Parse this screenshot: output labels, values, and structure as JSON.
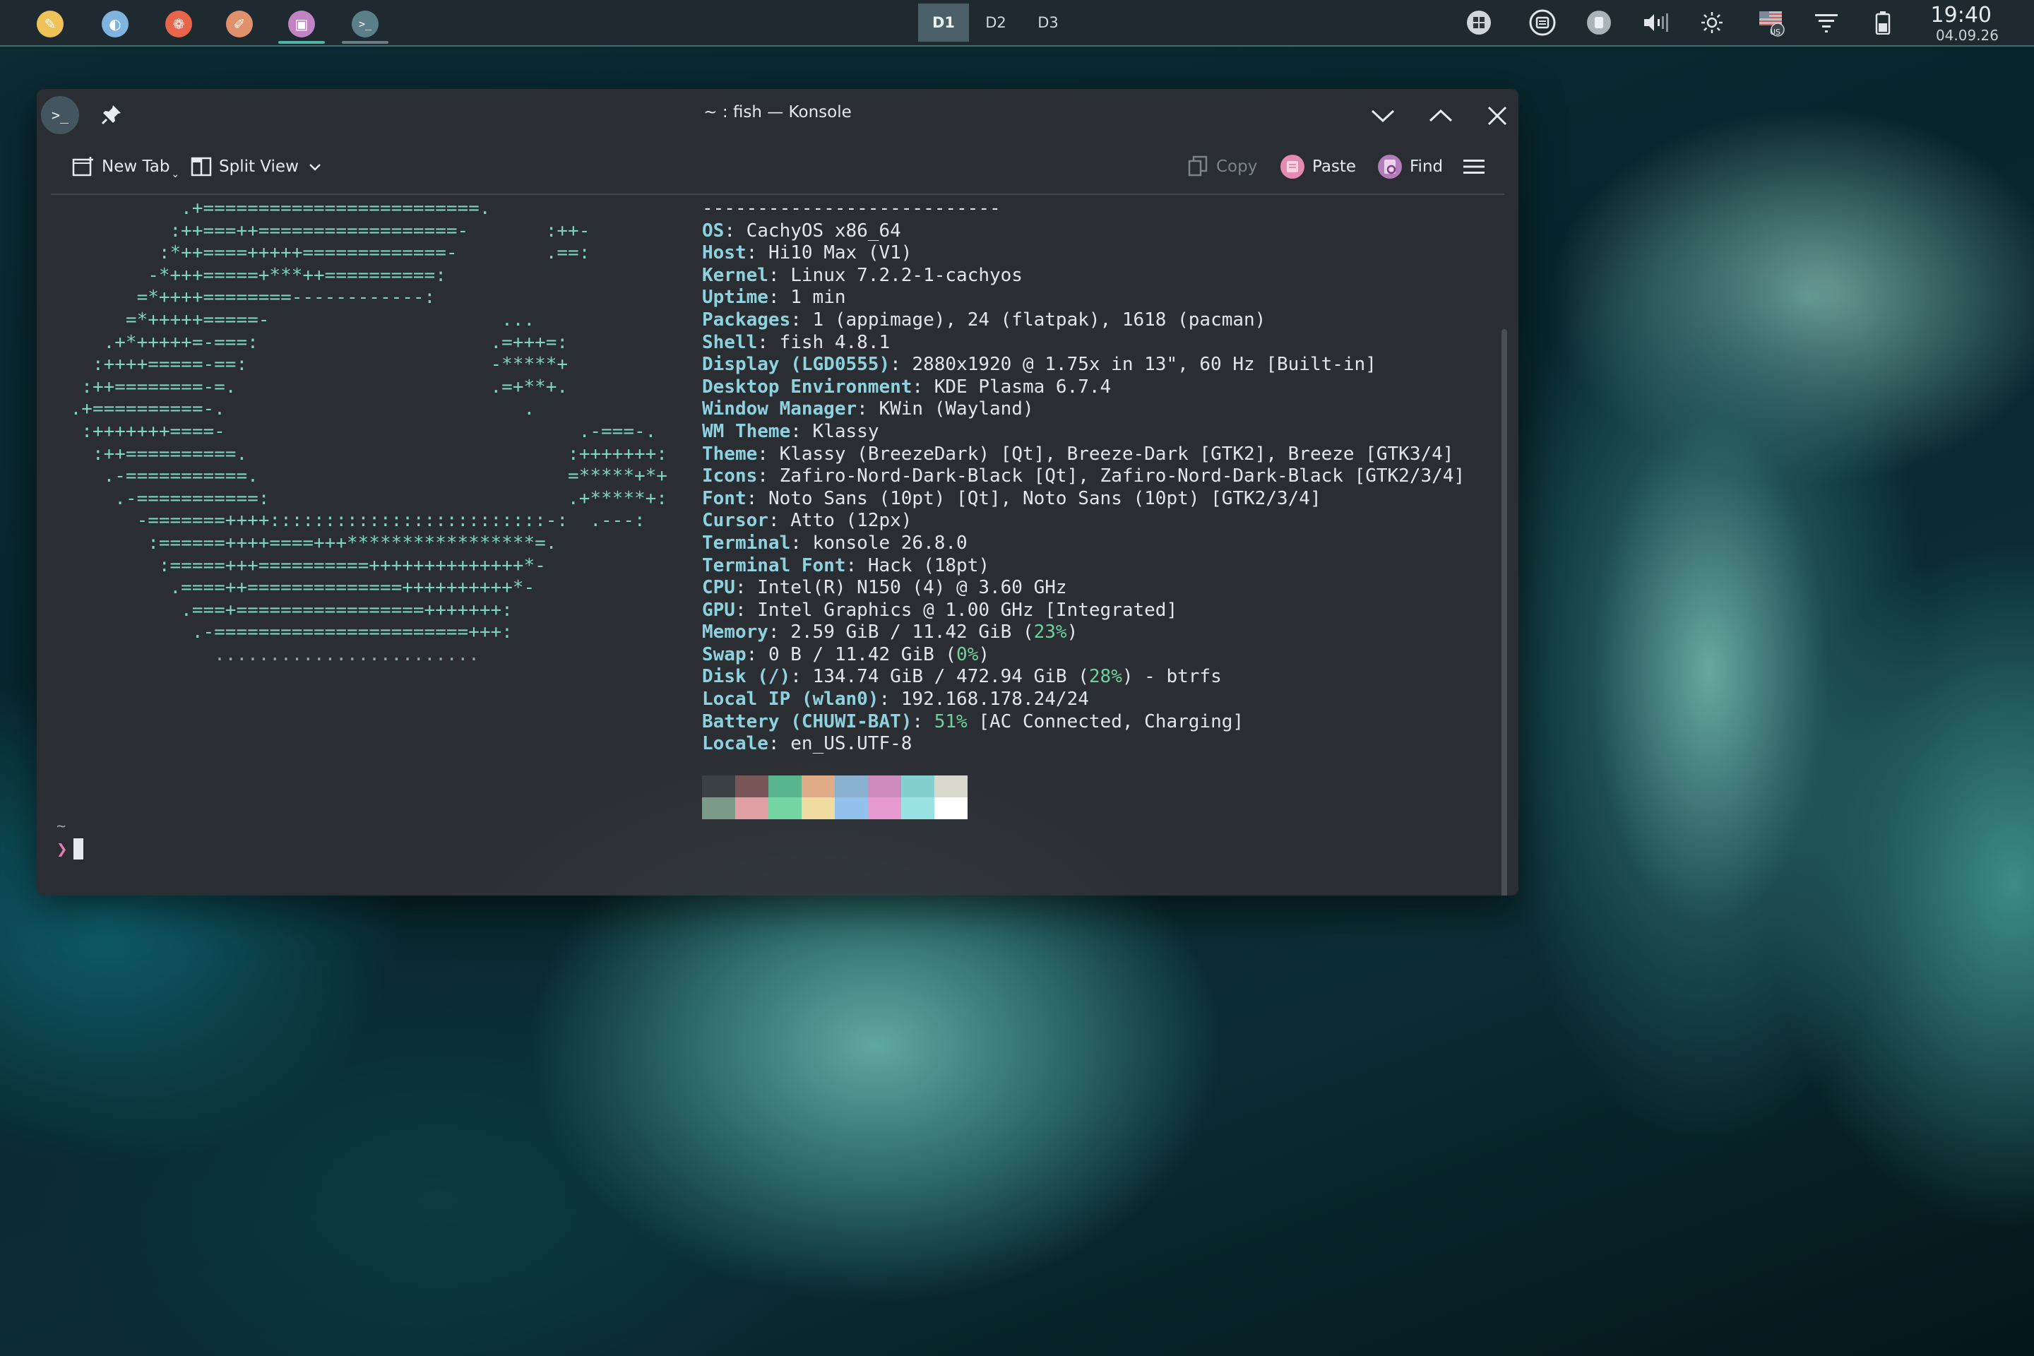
{
  "panel": {
    "tasks": [
      {
        "name": "app-launcher-icon",
        "glyph": "✎",
        "color": "#f0c35a"
      },
      {
        "name": "browser-icon",
        "glyph": "◐",
        "color": "#7fb3e0"
      },
      {
        "name": "firefox-icon",
        "glyph": "❁",
        "color": "#e8644a"
      },
      {
        "name": "notes-icon",
        "glyph": "✐",
        "color": "#e0906a"
      },
      {
        "name": "system-monitor-icon",
        "glyph": "▣",
        "color": "#c183c4"
      },
      {
        "name": "konsole-icon",
        "glyph": ">_",
        "color": "#5b7f8a"
      }
    ],
    "desktops": [
      "D1",
      "D2",
      "D3"
    ],
    "active_desktop": "D1",
    "tray_icons": [
      "app-grid-icon",
      "printer-icon",
      "clipboard-icon",
      "volume-icon",
      "brightness-icon",
      "keyboard-layout-icon",
      "network-icon",
      "battery-icon"
    ],
    "keyboard_layout": "US",
    "time": "19:40",
    "date": "04.09.26"
  },
  "window": {
    "title": "~ : fish — Konsole",
    "toolbar": {
      "new_tab": "New Tab",
      "split_view": "Split View",
      "copy": "Copy",
      "paste": "Paste",
      "find": "Find"
    }
  },
  "terminal": {
    "logo": [
      "           .+=========================.",
      "          :++===++==================-       :++-",
      "         :*++====+++++=============-        .==:",
      "        -*+++=====+***++==========:",
      "       =*++++========------------:",
      "      =*+++++=====-                     ...",
      "    .+*+++++=-===:                     .=+++=:",
      "   :++++=====-==:                      -*****+",
      "  :++========-=.                       .=+**+.",
      " .+==========-.                           .",
      "  :+++++++====-                                .-===-.",
      "   :++==========.                             :+++++++:",
      "    .-===========.                            =*****+*+",
      "     .-===========:                           .+*****+:",
      "       -=======++++:::::::::::::::::::::::::-:  .---:",
      "        :======++++====+++*****************=.",
      "         :=====+++==========++++++++++++++*-",
      "          .====++==============++++++++++*-",
      "           .===+=================+++++++:",
      "            .-=======================+++:",
      "              ........................"
    ],
    "rule": "---------------------------",
    "info": [
      {
        "k": "OS",
        "v": "CachyOS x86_64"
      },
      {
        "k": "Host",
        "v": "Hi10 Max (V1)"
      },
      {
        "k": "Kernel",
        "v": "Linux 7.2.2-1-cachyos"
      },
      {
        "k": "Uptime",
        "v": "1 min"
      },
      {
        "k": "Packages",
        "v": "1 (appimage), 24 (flatpak), 1618 (pacman)"
      },
      {
        "k": "Shell",
        "v": "fish 4.8.1"
      },
      {
        "k": "Display (LGD0555)",
        "v": "2880x1920 @ 1.75x in 13\", 60 Hz [Built-in]"
      },
      {
        "k": "Desktop Environment",
        "v": "KDE Plasma 6.7.4"
      },
      {
        "k": "Window Manager",
        "v": "KWin (Wayland)"
      },
      {
        "k": "WM Theme",
        "v": "Klassy"
      },
      {
        "k": "Theme",
        "v": "Klassy (BreezeDark) [Qt], Breeze-Dark [GTK2], Breeze [GTK3/4]"
      },
      {
        "k": "Icons",
        "v": "Zafiro-Nord-Dark-Black [Qt], Zafiro-Nord-Dark-Black [GTK2/3/4]"
      },
      {
        "k": "Font",
        "v": "Noto Sans (10pt) [Qt], Noto Sans (10pt) [GTK2/3/4]"
      },
      {
        "k": "Cursor",
        "v": "Atto (12px)"
      },
      {
        "k": "Terminal",
        "v": "konsole 26.8.0"
      },
      {
        "k": "Terminal Font",
        "v": "Hack (18pt)"
      },
      {
        "k": "CPU",
        "v": "Intel(R) N150 (4) @ 3.60 GHz"
      },
      {
        "k": "GPU",
        "v": "Intel Graphics @ 1.00 GHz [Integrated]"
      },
      {
        "k": "Memory",
        "v": "2.59 GiB / 11.42 GiB (",
        "pct": "23%",
        "after": ")"
      },
      {
        "k": "Swap",
        "v": "0 B / 11.42 GiB (",
        "pct": "0%",
        "after": ")"
      },
      {
        "k": "Disk (/)",
        "v": "134.74 GiB / 472.94 GiB (",
        "pct": "28%",
        "after": ") - btrfs"
      },
      {
        "k": "Local IP (wlan0)",
        "v": "192.168.178.24/24"
      },
      {
        "k": "Battery (CHUWI-BAT)",
        "v": "",
        "pct": "51%",
        "after": " [AC Connected, Charging]"
      },
      {
        "k": "Locale",
        "v": "en_US.UTF-8"
      }
    ],
    "palette": [
      [
        "#3b4045",
        "#7a5558",
        "#5ab58e",
        "#e0ac88",
        "#8ab0cf",
        "#cf8abe",
        "#84cfcf",
        "#d8d8cc"
      ],
      [
        "#7c9a88",
        "#e0a0a6",
        "#74d4a4",
        "#f0dca0",
        "#92c2ec",
        "#e89ad0",
        "#9ae2e2",
        "#ffffff"
      ]
    ],
    "prompt_dir": "~",
    "prompt_symbol": "❯"
  },
  "colors": {
    "accent": "#4fb2a4",
    "key": "#8ed2df",
    "percent": "#6fd0a0",
    "logo": "#7fd3c2"
  }
}
